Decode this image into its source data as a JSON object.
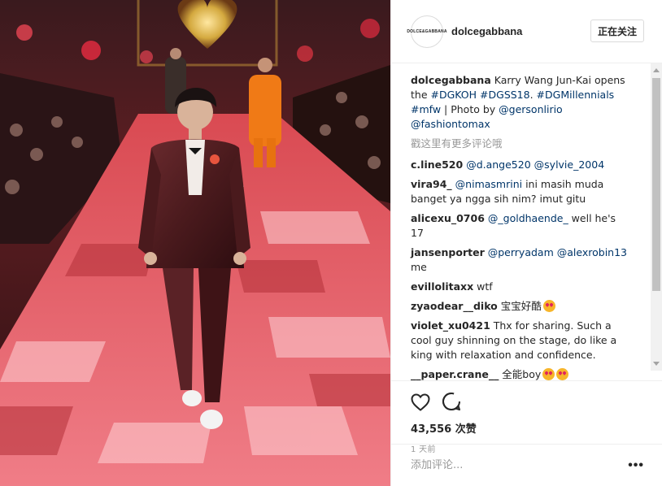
{
  "header": {
    "avatar_text": "DOLCE&GABBANA",
    "username": "dolcegabbana",
    "follow_label": "正在关注"
  },
  "caption": {
    "username": "dolcegabbana",
    "text_1": " Karry Wang Jun-Kai opens the ",
    "tag_1": "#DGKOH",
    "tag_2": "#DGSS18",
    "sep_1": ". ",
    "tag_3": "#DGMillennials",
    "tag_4": "#mfw",
    "text_2": " | Photo by ",
    "mention_1": "@gersonlirio",
    "mention_2": "@fashiontomax"
  },
  "more_comments": "戳这里有更多评论哦",
  "comments": [
    {
      "user": "c.line520",
      "t1": " ",
      "m1": "@d.ange520",
      "t2": " ",
      "m2": "@sylvie_2004",
      "t3": ""
    },
    {
      "user": "vira94_",
      "t1": " ",
      "m1": "@nimasmrini",
      "t2": " ini masih muda banget ya ngga sih nim? imut gitu",
      "m2": "",
      "t3": ""
    },
    {
      "user": "alicexu_0706",
      "t1": " ",
      "m1": "@_goldhaende_",
      "t2": " well he's 17",
      "m2": "",
      "t3": ""
    },
    {
      "user": "jansenporter",
      "t1": " ",
      "m1": "@perryadam",
      "t2": " ",
      "m2": "@alexrobin13",
      "t3": " me"
    },
    {
      "user": "evillolitaxx",
      "t1": " wtf",
      "m1": "",
      "t2": "",
      "m2": "",
      "t3": ""
    },
    {
      "user": "zyaodear__diko",
      "t1": " 宝宝好酷",
      "m1": "",
      "t2": "",
      "m2": "",
      "t3": "",
      "emoji": 1
    },
    {
      "user": "violet_xu0421",
      "t1": " Thx for sharing. Such a cool guy shinning on the stage, do like a king with relaxation and confidence.",
      "m1": "",
      "t2": "",
      "m2": "",
      "t3": ""
    },
    {
      "user": "__paper.crane__",
      "t1": " 全能boy",
      "m1": "",
      "t2": "",
      "m2": "",
      "t3": "",
      "emoji": 2
    }
  ],
  "actions": {
    "like_icon": "heart-icon",
    "comment_icon": "comment-bubble-icon",
    "likes_label": "43,556 次赞",
    "time_label": "1 天前"
  },
  "add_comment": {
    "placeholder": "添加评论...",
    "more_label": "•••"
  },
  "colors": {
    "link": "#003569",
    "text": "#262626",
    "muted": "#999999",
    "border": "#efefef"
  }
}
